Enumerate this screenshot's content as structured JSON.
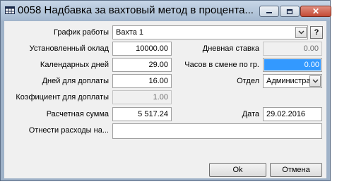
{
  "window": {
    "title": "0058 Надбавка за вахтовый метод в процента...",
    "icon": "table-icon"
  },
  "titlebar_buttons": {
    "minimize": "minimize-icon",
    "maximize": "maximize-icon",
    "close": "✕"
  },
  "form": {
    "schedule_label": "График работы",
    "schedule_value": "Вахта 1",
    "help_label": "?",
    "salary_label": "Установленный оклад",
    "salary_value": "10000.00",
    "daily_rate_label": "Дневная ставка",
    "daily_rate_value": "0.00",
    "calendar_days_label": "Календарных дней",
    "calendar_days_value": "29.00",
    "hours_label": "Часов в смене по гр.",
    "hours_value": "0.00",
    "pay_days_label": "Дней для доплаты",
    "pay_days_value": "16.00",
    "dept_label": "Отдел",
    "dept_value": "Администра",
    "coef_label": "Коэфициент для доплаты",
    "coef_value": "1.00",
    "amount_label": "Расчетная сумма",
    "amount_value": "5 517.24",
    "date_label": "Дата",
    "date_value": "29.02.2016",
    "expense_label": "Отнести расходы на...",
    "expense_value": ""
  },
  "buttons": {
    "ok": "Ok",
    "cancel": "Отмена"
  },
  "colors": {
    "titlebar": "#a5b9d0",
    "selection": "#3399ff",
    "client": "#f0f0f0"
  }
}
